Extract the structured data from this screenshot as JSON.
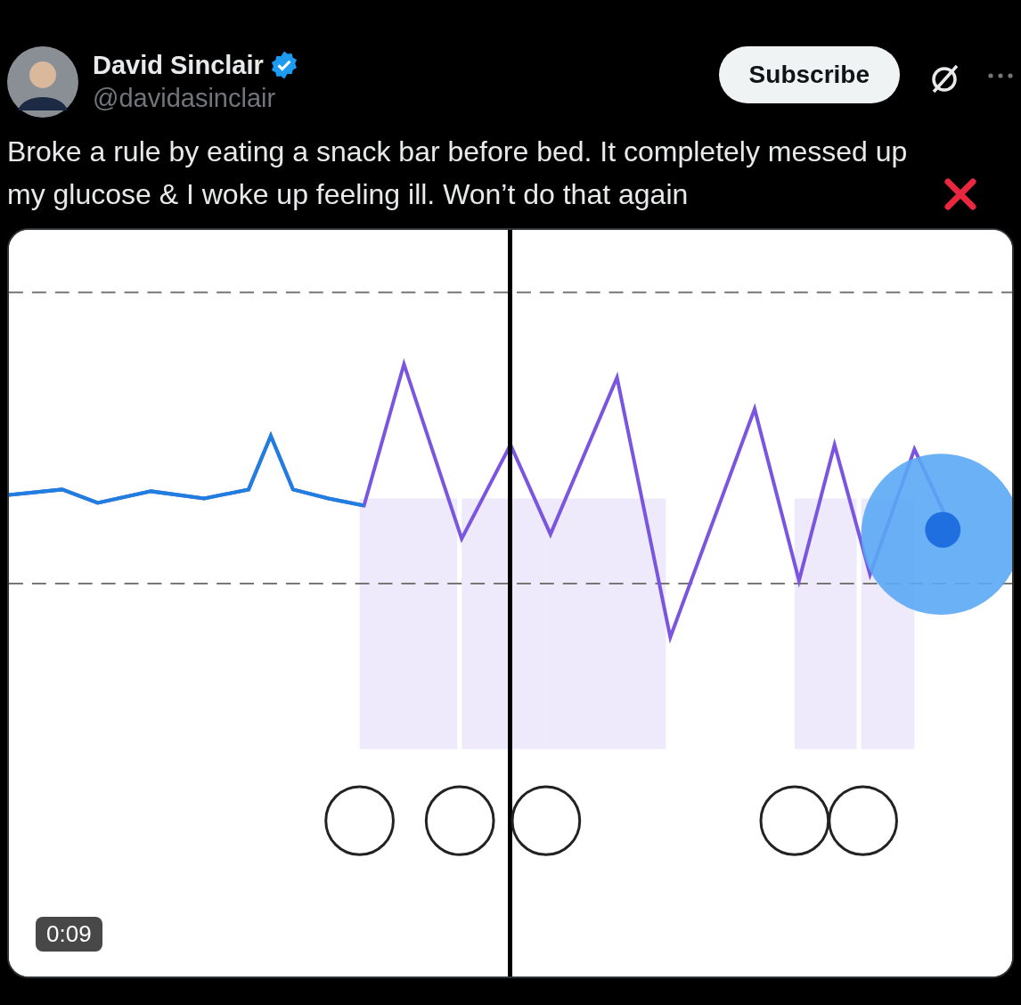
{
  "author": {
    "name": "David Sinclair",
    "verified": true,
    "handle": "@davidasinclair"
  },
  "subscribe": {
    "label": "Subscribe"
  },
  "text": "Broke a rule by eating a snack bar before bed. It completely messed up my glucose & I woke up feeling ill. Won’t do that again",
  "media": {
    "kind": "picture",
    "timestamp": "0:09"
  }
}
